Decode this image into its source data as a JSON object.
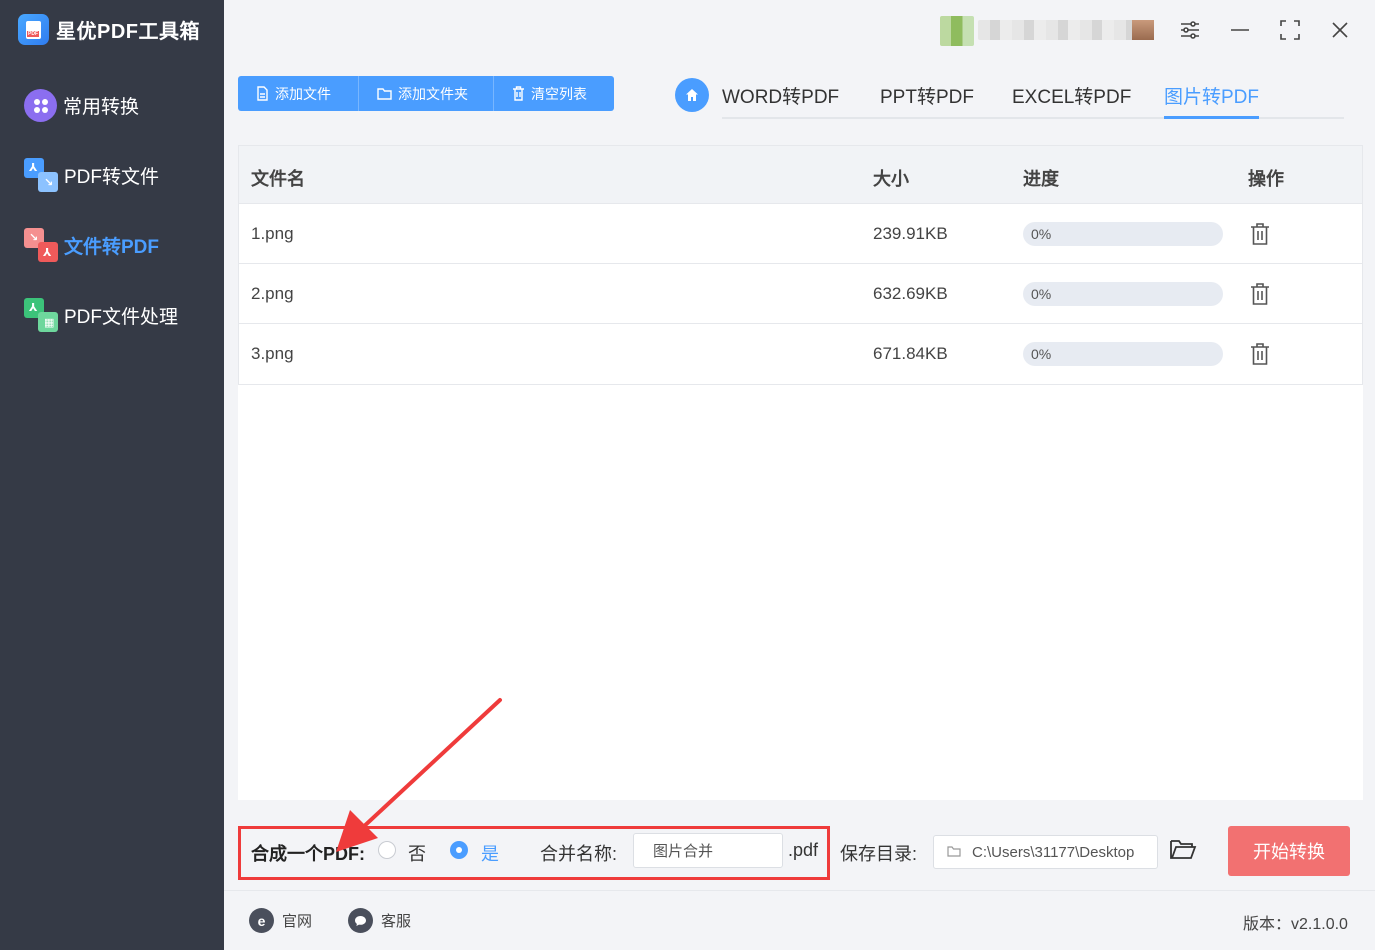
{
  "app": {
    "title": "星优PDF工具箱"
  },
  "sidebar": {
    "items": [
      {
        "label": "常用转换",
        "icon": "apps-icon",
        "active": false
      },
      {
        "label": "PDF转文件",
        "icon": "pdf-to-file-icon",
        "active": false
      },
      {
        "label": "文件转PDF",
        "icon": "file-to-pdf-icon",
        "active": true
      },
      {
        "label": "PDF文件处理",
        "icon": "pdf-process-icon",
        "active": false
      }
    ]
  },
  "toolbar": {
    "add_file": "添加文件",
    "add_folder": "添加文件夹",
    "clear_list": "清空列表"
  },
  "tabs": [
    {
      "label": "WORD转PDF",
      "active": false
    },
    {
      "label": "PPT转PDF",
      "active": false
    },
    {
      "label": "EXCEL转PDF",
      "active": false
    },
    {
      "label": "图片转PDF",
      "active": true
    }
  ],
  "table": {
    "headers": {
      "name": "文件名",
      "size": "大小",
      "progress": "进度",
      "action": "操作"
    },
    "rows": [
      {
        "name": "1.png",
        "size": "239.91KB",
        "progress": "0%",
        "progress_value": 0
      },
      {
        "name": "2.png",
        "size": "632.69KB",
        "progress": "0%",
        "progress_value": 0
      },
      {
        "name": "3.png",
        "size": "671.84KB",
        "progress": "0%",
        "progress_value": 0
      }
    ]
  },
  "options": {
    "merge_label": "合成一个PDF:",
    "no_label": "否",
    "yes_label": "是",
    "merge_yes": true,
    "merge_name_label": "合并名称:",
    "merge_name_value": "图片合并",
    "ext": ".pdf",
    "save_dir_label": "保存目录:",
    "save_dir_value": "C:\\Users\\31177\\Desktop",
    "start_label": "开始转换"
  },
  "footer": {
    "website": "官网",
    "support": "客服",
    "version": "版本：v2.1.0.0"
  },
  "colors": {
    "accent": "#4a9dff",
    "sidebar_bg": "#353a46",
    "start_button": "#f27171",
    "annotation": "#ef3b3b"
  }
}
